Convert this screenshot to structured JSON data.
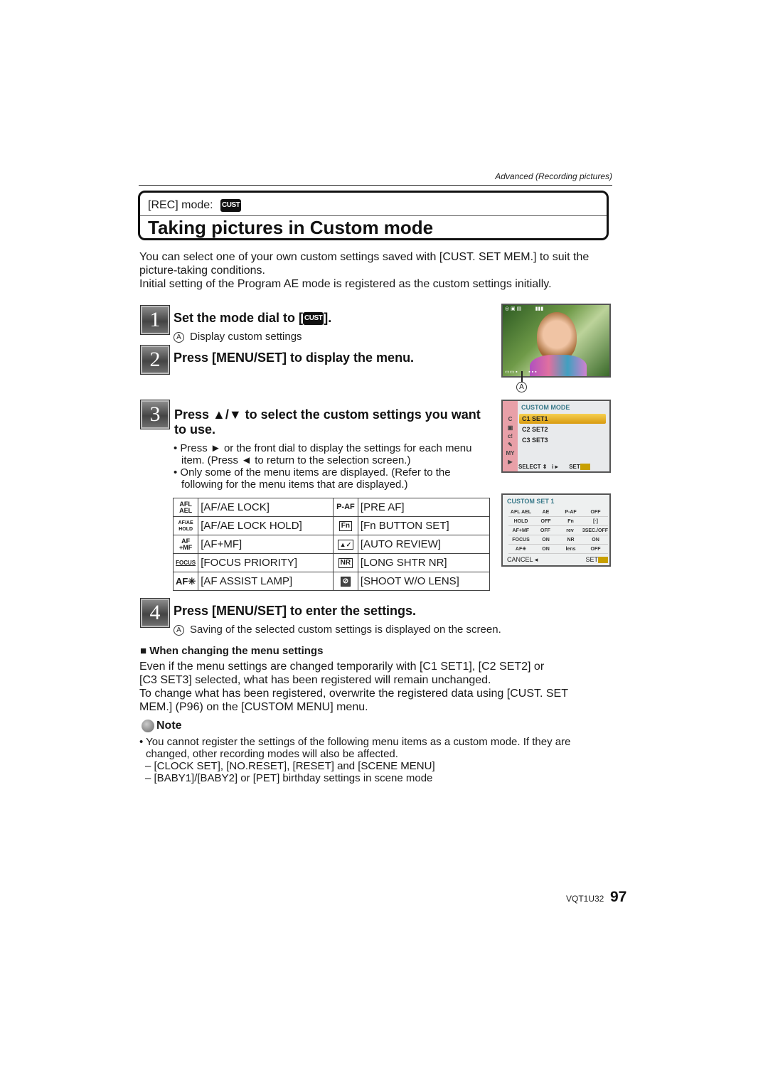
{
  "header": {
    "section_caption": "Advanced (Recording pictures)"
  },
  "title_box": {
    "rec_mode_label": "[REC] mode:",
    "mode_badge": "CUST",
    "title": "Taking pictures in Custom mode"
  },
  "intro": {
    "line1": "You can select one of your own custom settings saved with [CUST. SET MEM.] to suit the",
    "line2": "picture-taking conditions.",
    "line3": "Initial setting of the Program AE mode is registered as the custom settings initially."
  },
  "steps": [
    {
      "number": "1",
      "title_prefix": "Set the mode dial to [",
      "title_badge": "CUST",
      "title_suffix": "].",
      "note_marker": "A",
      "note": "Display custom settings"
    },
    {
      "number": "2",
      "title": "Press [MENU/SET] to display the menu."
    },
    {
      "number": "3",
      "title_line1": "Press ▲/▼ to select the custom settings you want",
      "title_line2": "to use.",
      "bullets": [
        {
          "line1": "Press ► or the front dial to display the settings for each menu",
          "line2": "item. (Press ◄ to return to the selection screen.)"
        },
        {
          "line1": "Only some of the menu items are displayed. (Refer to the",
          "line2": "following for the menu items that are displayed.)"
        }
      ]
    },
    {
      "number": "4",
      "title": "Press [MENU/SET] to enter the settings.",
      "note_marker": "A",
      "note": "Saving of the selected custom settings is displayed on the screen."
    }
  ],
  "menu_table": {
    "rows": [
      {
        "left_icon": "AFL AEL",
        "left_label": "[AF/AE LOCK]",
        "right_icon": "P-AF",
        "right_label": "[PRE AF]"
      },
      {
        "left_icon": "AF/AE HOLD",
        "left_label": "[AF/AE LOCK HOLD]",
        "right_icon": "Fn",
        "right_label": "[Fn BUTTON SET]"
      },
      {
        "left_icon": "AF +MF",
        "left_label": "[AF+MF]",
        "right_icon": "review",
        "right_label": "[AUTO REVIEW]"
      },
      {
        "left_icon": "FOCUS",
        "left_label": "[FOCUS PRIORITY]",
        "right_icon": "NR",
        "right_label": "[LONG SHTR NR]"
      },
      {
        "left_icon": "AF✳",
        "left_label": "[AF ASSIST LAMP]",
        "right_icon": "no-lens",
        "right_label": "[SHOOT W/O LENS]"
      }
    ]
  },
  "screens": {
    "photo_marker": "A",
    "custom_mode": {
      "title": "CUSTOM MODE",
      "items": [
        "C1 SET1",
        "C2 SET2",
        "C3 SET3"
      ],
      "selected_index": 0,
      "side_icons": [
        "C",
        "▣",
        "c!",
        "✎",
        "MY",
        "▶"
      ],
      "footer_select": "SELECT",
      "footer_set": "SET",
      "highlight_color": "#e8b020",
      "side_color": "#e8a0a8"
    },
    "custom_set": {
      "title": "CUSTOM SET 1",
      "rows": [
        [
          "AFL AEL",
          "AE",
          "P-AF",
          "OFF"
        ],
        [
          "HOLD",
          "OFF",
          "Fn",
          "[·]"
        ],
        [
          "AF+MF",
          "OFF",
          "rev",
          "3SEC./OFF"
        ],
        [
          "FOCUS",
          "ON",
          "NR",
          "ON"
        ],
        [
          "AF✳",
          "ON",
          "lens",
          "OFF"
        ]
      ],
      "footer_cancel": "CANCEL",
      "footer_set": "SET"
    }
  },
  "changing_section": {
    "heading": "When changing the menu settings",
    "line1": "Even if the menu settings are changed temporarily with [C1 SET1], [C2 SET2] or",
    "line2": "[C3 SET3] selected, what has been registered will remain unchanged.",
    "line3": "To change what has been registered, overwrite the registered data using [CUST. SET",
    "line4": "MEM.] (P96) on the [CUSTOM MENU] menu."
  },
  "note": {
    "heading": "Note",
    "bullet_line1": "You cannot register the settings of the following menu items as a custom mode. If they are",
    "bullet_line2": "changed, other recording modes will also be affected.",
    "dash_items": [
      "[CLOCK SET], [NO.RESET], [RESET] and [SCENE MENU]",
      "[BABY1]/[BABY2] or [PET] birthday settings in scene mode"
    ]
  },
  "footer": {
    "code": "VQT1U32",
    "page": "97"
  }
}
